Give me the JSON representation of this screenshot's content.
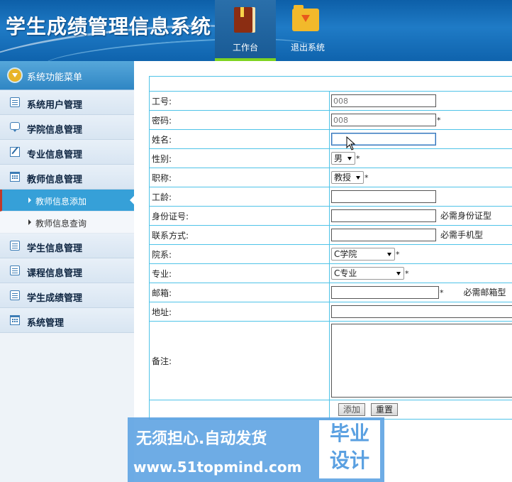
{
  "header": {
    "app_title": "学生成绩管理信息系统",
    "nav": [
      {
        "label": "工作台",
        "icon": "book-icon",
        "active": true
      },
      {
        "label": "退出系统",
        "icon": "folder-download-icon",
        "active": false
      }
    ],
    "accent_color": "#7ed321"
  },
  "sidebar": {
    "menu_title": "系统功能菜单",
    "items": [
      {
        "label": "系统用户管理",
        "icon": "list-icon"
      },
      {
        "label": "学院信息管理",
        "icon": "chat-icon"
      },
      {
        "label": "专业信息管理",
        "icon": "edit-icon"
      },
      {
        "label": "教师信息管理",
        "icon": "calendar-icon"
      },
      {
        "label": "学生信息管理",
        "icon": "list-icon"
      },
      {
        "label": "课程信息管理",
        "icon": "list-icon"
      },
      {
        "label": "学生成绩管理",
        "icon": "list-icon"
      },
      {
        "label": "系统管理",
        "icon": "calendar-icon"
      }
    ],
    "sub_items": [
      {
        "label": "教师信息添加",
        "active": true
      },
      {
        "label": "教师信息查询",
        "active": false
      }
    ]
  },
  "form": {
    "fields": {
      "id": {
        "label": "工号:",
        "value": "008"
      },
      "password": {
        "label": "密码:",
        "value": "008",
        "required": "*"
      },
      "name": {
        "label": "姓名:",
        "value": ""
      },
      "gender": {
        "label": "性别:",
        "value": "男",
        "required": "*"
      },
      "title": {
        "label": "职称:",
        "value": "教授",
        "required": "*"
      },
      "years": {
        "label": "工龄:",
        "value": ""
      },
      "idcard": {
        "label": "身份证号:",
        "value": "",
        "hint": "必需身份证型"
      },
      "phone": {
        "label": "联系方式:",
        "value": "",
        "hint": "必需手机型"
      },
      "college": {
        "label": "院系:",
        "value": "C学院",
        "required": "*"
      },
      "major": {
        "label": "专业:",
        "value": "C专业",
        "required": "*"
      },
      "email": {
        "label": "邮箱:",
        "value": "",
        "required": "*",
        "hint": "必需邮箱型"
      },
      "address": {
        "label": "地址:",
        "value": ""
      },
      "remark": {
        "label": "备注:",
        "value": ""
      }
    },
    "buttons": {
      "add": "添加",
      "reset": "重置"
    }
  },
  "watermark": {
    "line1": "无须担心.自动发货",
    "line2": "www.51topmind.com",
    "stamp_line1": "毕业",
    "stamp_line2": "设计"
  }
}
